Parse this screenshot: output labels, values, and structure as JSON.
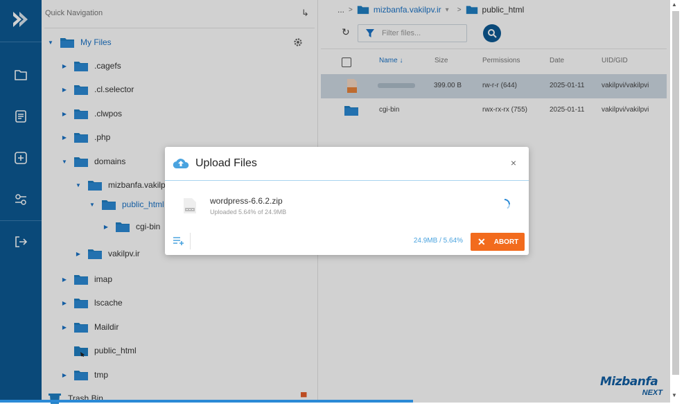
{
  "app": {
    "rail": {
      "icons": [
        "logo-icon",
        "folder-icon",
        "document-icon",
        "add-icon",
        "settings-icon",
        "logout-icon"
      ]
    }
  },
  "tree": {
    "title": "Quick Navigation",
    "root": "My Files",
    "nodes": [
      {
        "label": ".cagefs",
        "depth": 1,
        "expanded": false
      },
      {
        "label": ".cl.selector",
        "depth": 1,
        "expanded": false
      },
      {
        "label": ".clwpos",
        "depth": 1,
        "expanded": false
      },
      {
        "label": ".php",
        "depth": 1,
        "expanded": false
      },
      {
        "label": "domains",
        "depth": 1,
        "expanded": true
      },
      {
        "label": "mizbanfa.vakilpv.ir",
        "depth": 2,
        "expanded": true
      },
      {
        "label": "public_html",
        "depth": 3,
        "expanded": true,
        "active": true
      },
      {
        "label": "cgi-bin",
        "depth": 4,
        "expanded": false
      },
      {
        "label": "vakilpv.ir",
        "depth": 2,
        "expanded": false
      },
      {
        "label": "imap",
        "depth": 1,
        "expanded": false
      },
      {
        "label": "lscache",
        "depth": 1,
        "expanded": false
      },
      {
        "label": "Maildir",
        "depth": 1,
        "expanded": false
      },
      {
        "label": "public_html",
        "depth": 1,
        "expanded": false,
        "symlink": true
      },
      {
        "label": "tmp",
        "depth": 1,
        "expanded": false
      },
      {
        "label": "Trash Bin",
        "depth": 0
      }
    ]
  },
  "breadcrumb": {
    "ellipsis": "...",
    "items": [
      "mizbanfa.vakilpv.ir",
      "public_html"
    ]
  },
  "filter": {
    "placeholder": "Filter files..."
  },
  "table": {
    "headers": {
      "name": "Name",
      "size": "Size",
      "permissions": "Permissions",
      "date": "Date",
      "uid": "UID/GID"
    },
    "sort": {
      "column": "name",
      "direction": "descending"
    },
    "rows": [
      {
        "name": "",
        "size": "399.00 B",
        "permissions": "rw-r-r (644)",
        "date": "2025-01-11",
        "uid": "vakilpvi/vakilpvi",
        "selected": true,
        "blurred": true
      },
      {
        "name": "cgi-bin",
        "size": "",
        "permissions": "rwx-rx-rx (755)",
        "date": "2025-01-11",
        "uid": "vakilpvi/vakilpvi",
        "selected": false
      }
    ]
  },
  "modal": {
    "title": "Upload Files",
    "file_name": "wordpress-6.6.2.zip",
    "progress_text": "Uploaded 5.64% of 24.9MB",
    "status": "24.9MB / 5.64%",
    "abort_label": "ABORT",
    "progress_percent": 5.64
  },
  "watermark": {
    "line1": "Mizbanfa",
    "line2": "NEXT"
  },
  "colors": {
    "rail": "#0d5a94",
    "accent": "#1a73c7",
    "abort": "#f26b1d",
    "selected_row": "#cfd9e3"
  }
}
